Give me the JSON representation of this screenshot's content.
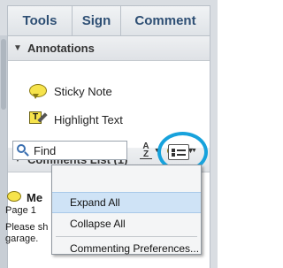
{
  "tabs": {
    "tools": "Tools",
    "sign": "Sign",
    "comment": "Comment"
  },
  "annotations": {
    "header": "Annotations",
    "items": [
      {
        "label": "Sticky Note",
        "icon": "sticky-note-icon"
      },
      {
        "label": "Highlight Text",
        "icon": "highlight-text-icon"
      }
    ]
  },
  "comments_list": {
    "header": "Comments List (1)",
    "find_value": "Find",
    "entry": {
      "title": "Me",
      "page": "Page 1",
      "text": "Please sh",
      "text2": "garage."
    }
  },
  "menu": {
    "items": [
      "Expand All",
      "Collapse All",
      "Commenting Preferences..."
    ],
    "active_index": 0
  },
  "colors": {
    "tab_text": "#2e4f74",
    "highlight_ring": "#17a2dc",
    "menu_active": "#cfe3f6",
    "sticky": "#f6e34c"
  }
}
